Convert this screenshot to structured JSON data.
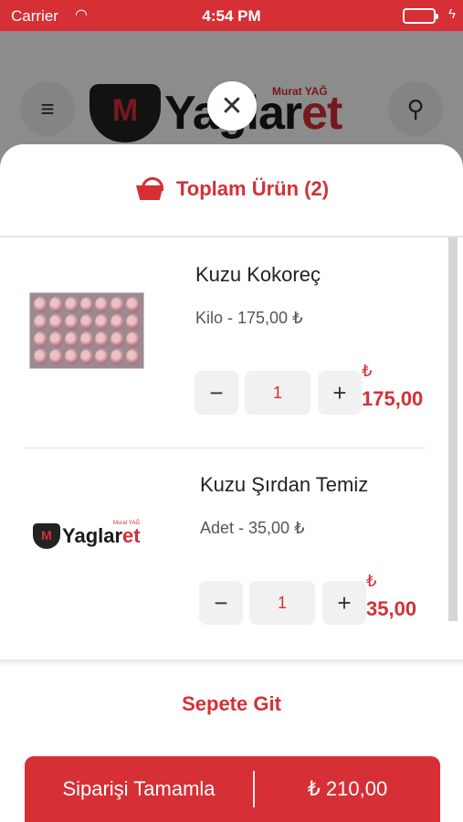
{
  "status_bar": {
    "carrier": "Carrier",
    "time": "4:54 PM"
  },
  "header": {
    "brand_main": "Yaglar",
    "brand_accent": "et",
    "brand_sub": "Murat YAĞ"
  },
  "sheet": {
    "title": "Toplam Ürün (2)",
    "items": [
      {
        "name": "Kuzu Kokoreç",
        "unit_price": "Kilo - 175,00 ₺",
        "quantity": "1",
        "currency": "₺",
        "total": "175,00",
        "image": "meat-photo"
      },
      {
        "name": "Kuzu Şırdan Temiz",
        "unit_price": "Adet - 35,00 ₺",
        "quantity": "1",
        "currency": "₺",
        "total": "35,00",
        "image": "brand-logo"
      }
    ],
    "go_to_cart": "Sepete Git",
    "complete_order": {
      "label": "Siparişi Tamamla",
      "total": "₺ 210,00"
    }
  },
  "colors": {
    "accent": "#d62f35",
    "quantity_bg": "#f1f1f1"
  }
}
